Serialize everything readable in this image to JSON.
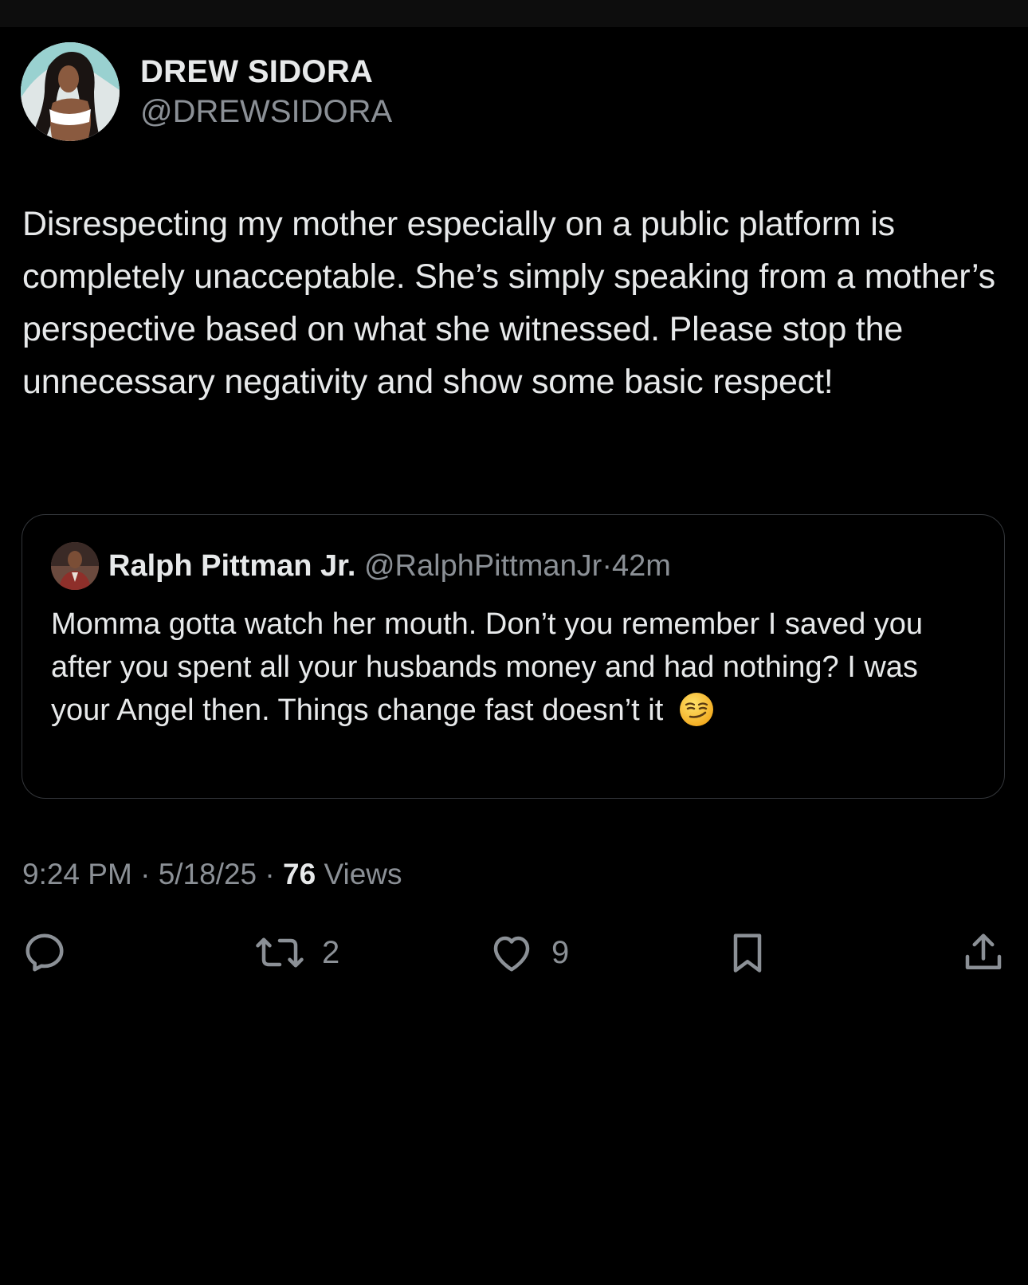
{
  "tweet": {
    "author": {
      "display_name": "DREW SIDORA",
      "handle": "@DREWSIDORA"
    },
    "text": "Disrespecting my mother especially on a public platform is completely unacceptable. She’s simply speaking from a mother’s perspective based on what she witnessed. Please stop the unnecessary negativity and show some basic respect!",
    "quoted": {
      "display_name": "Ralph Pittman Jr.",
      "handle": "@RalphPittmanJr",
      "separator": "·",
      "time": "42m",
      "text": "Momma gotta watch her mouth. Don’t you remember I saved you after you spent all your husbands money and had nothing? I was your Angel then. Things change fast doesn’t it",
      "emoji": "smirking-face-emoji"
    },
    "meta": {
      "time": "9:24 PM",
      "date": "5/18/25",
      "separator": "·",
      "views_count": "76",
      "views_label": "Views"
    },
    "actions": {
      "reply_icon": "reply-icon",
      "retweet_icon": "retweet-icon",
      "retweet_count": "2",
      "like_icon": "heart-icon",
      "like_count": "9",
      "bookmark_icon": "bookmark-icon",
      "share_icon": "share-icon"
    }
  },
  "colors": {
    "background": "#000000",
    "text_primary": "#e7e9ea",
    "text_secondary": "#8b9096",
    "border": "#33363a"
  }
}
